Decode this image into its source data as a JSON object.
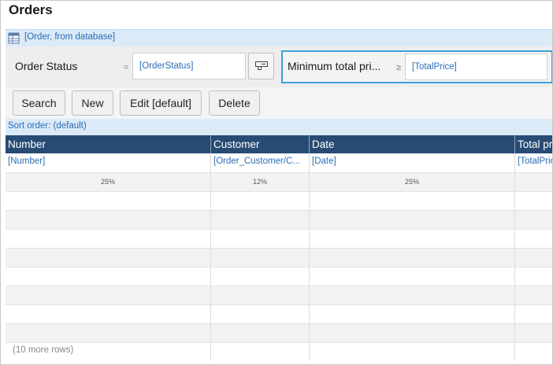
{
  "page": {
    "title": "Orders"
  },
  "datasource": {
    "icon": "database-grid-icon",
    "label": "[Order, from database]"
  },
  "search": {
    "fields": [
      {
        "label": "Order Status",
        "operator": "=",
        "value": "[OrderStatus]"
      },
      {
        "label": "Minimum total pri...",
        "operator": "≥",
        "value": "[TotalPrice]"
      }
    ],
    "select_button_icon": "select-icon"
  },
  "buttons": {
    "search": "Search",
    "new": "New",
    "edit": "Edit [default]",
    "delete": "Delete"
  },
  "sort": {
    "label": "Sort order: (default)"
  },
  "grid": {
    "columns": [
      {
        "header": "Number",
        "binding": "[Number]",
        "width": "25%"
      },
      {
        "header": "Customer",
        "binding": "[Order_Customer/C...",
        "width": "12%"
      },
      {
        "header": "Date",
        "binding": "[Date]",
        "width": "25%"
      },
      {
        "header": "Total pr",
        "binding": "[TotalPrice",
        "width": ""
      }
    ],
    "more_rows": "(10 more rows)"
  }
}
